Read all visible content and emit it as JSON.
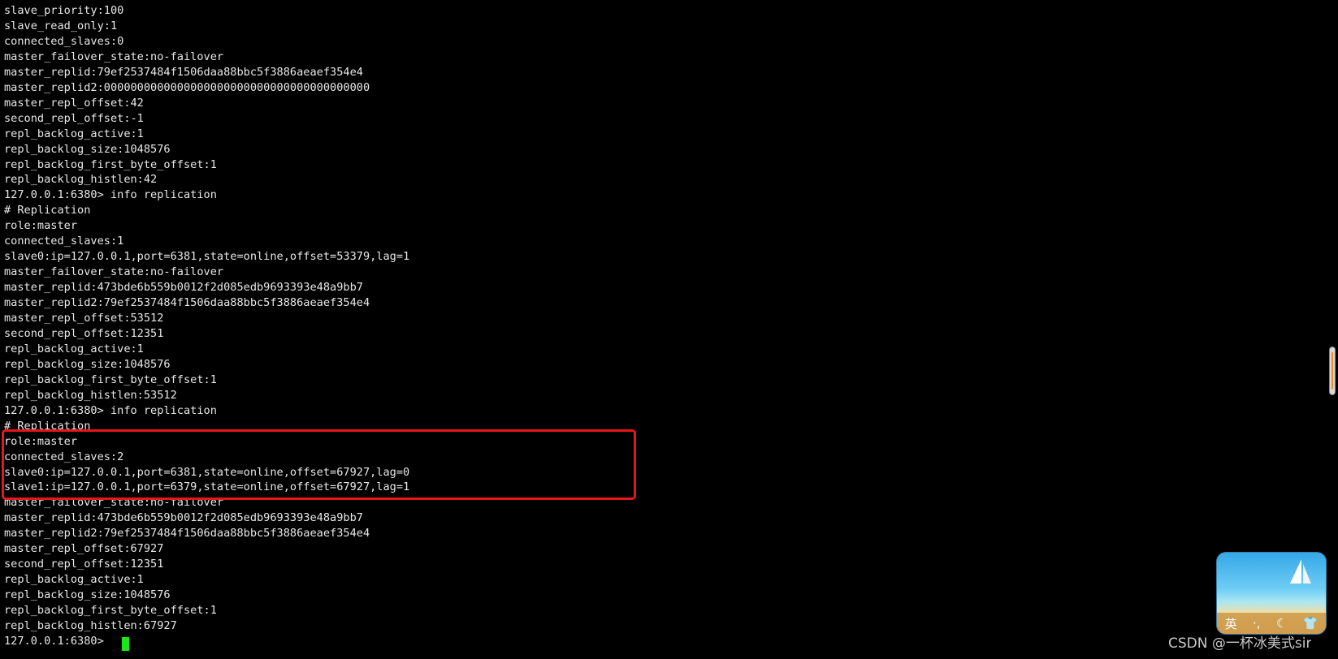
{
  "terminal": {
    "lines": [
      "slave_priority:100",
      "slave_read_only:1",
      "connected_slaves:0",
      "master_failover_state:no-failover",
      "master_replid:79ef2537484f1506daa88bbc5f3886aeaef354e4",
      "master_replid2:0000000000000000000000000000000000000000",
      "master_repl_offset:42",
      "second_repl_offset:-1",
      "repl_backlog_active:1",
      "repl_backlog_size:1048576",
      "repl_backlog_first_byte_offset:1",
      "repl_backlog_histlen:42",
      "127.0.0.1:6380> info replication",
      "# Replication",
      "role:master",
      "connected_slaves:1",
      "slave0:ip=127.0.0.1,port=6381,state=online,offset=53379,lag=1",
      "master_failover_state:no-failover",
      "master_replid:473bde6b559b0012f2d085edb9693393e48a9bb7",
      "master_replid2:79ef2537484f1506daa88bbc5f3886aeaef354e4",
      "master_repl_offset:53512",
      "second_repl_offset:12351",
      "repl_backlog_active:1",
      "repl_backlog_size:1048576",
      "repl_backlog_first_byte_offset:1",
      "repl_backlog_histlen:53512",
      "127.0.0.1:6380> info replication",
      "# Replication",
      "role:master",
      "connected_slaves:2",
      "slave0:ip=127.0.0.1,port=6381,state=online,offset=67927,lag=0",
      "slave1:ip=127.0.0.1,port=6379,state=online,offset=67927,lag=1",
      "master_failover_state:no-failover",
      "master_replid:473bde6b559b0012f2d085edb9693393e48a9bb7",
      "master_replid2:79ef2537484f1506daa88bbc5f3886aeaef354e4",
      "master_repl_offset:67927",
      "second_repl_offset:12351",
      "repl_backlog_active:1",
      "repl_backlog_size:1048576",
      "repl_backlog_first_byte_offset:1",
      "repl_backlog_histlen:67927",
      "127.0.0.1:6380> "
    ]
  },
  "ime": {
    "mode_label": "英",
    "icons": [
      "moon-icon",
      "shirt-icon"
    ]
  },
  "watermark": "CSDN @一杯冰美式sir",
  "colors": {
    "text": "#e8e8e8",
    "cursor": "#19e619",
    "highlight": "#e6161a",
    "background": "#000000"
  }
}
